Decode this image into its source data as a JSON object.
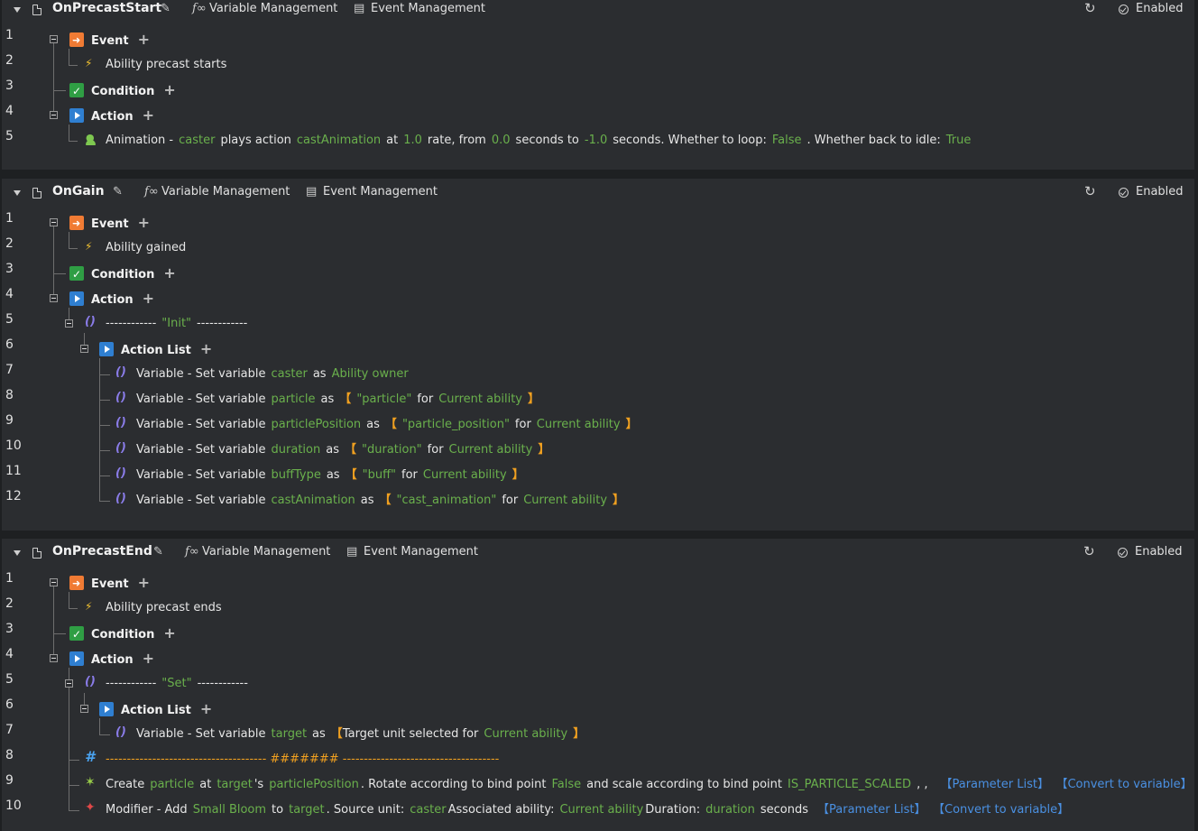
{
  "header_labels": {
    "variable_management": "Variable Management",
    "event_management": "Event Management",
    "enabled": "Enabled",
    "variable_management_icon": "fx-icon",
    "event_management_icon": "doc-arrow-icon"
  },
  "sections": {
    "event": "Event",
    "condition": "Condition",
    "action": "Action",
    "action_list": "Action List"
  },
  "triggers": [
    {
      "name": "OnPrecastStart",
      "lines": [
        "1",
        "2",
        "3",
        "4",
        "5"
      ],
      "event_text": "Ability precast starts",
      "animation": {
        "p1": "Animation -",
        "caster": "caster",
        "p2": "plays action",
        "anim": "castAnimation",
        "p3": "at",
        "rate": "1.0",
        "p4": "rate, from",
        "from": "0.0",
        "p5": "seconds to",
        "to": "-1.0",
        "p6": "seconds. Whether to loop:",
        "loop": "False",
        "p7": ". Whether back to idle:",
        "idle": "True"
      }
    },
    {
      "name": "OnGain",
      "lines": [
        "1",
        "2",
        "3",
        "4",
        "5",
        "6",
        "7",
        "8",
        "9",
        "10",
        "11",
        "12"
      ],
      "event_text": "Ability gained",
      "group_comment": "------------ \"Init\" ------------",
      "group_comment_parts": [
        "------------",
        "\"Init\"",
        "------------"
      ],
      "set_vars": [
        {
          "prefix": "Variable - Set variable",
          "name": "caster",
          "as": "as",
          "value": "Ability owner"
        },
        {
          "prefix": "Variable - Set variable",
          "name": "particle",
          "as": "as",
          "open": "【",
          "key": "\"particle\"",
          "for": "for",
          "target": "Current ability",
          "close": "】"
        },
        {
          "prefix": "Variable - Set variable",
          "name": "particlePosition",
          "as": "as",
          "open": "【",
          "key": "\"particle_position\"",
          "for": "for",
          "target": "Current ability",
          "close": "】"
        },
        {
          "prefix": "Variable - Set variable",
          "name": "duration",
          "as": "as",
          "open": "【",
          "key": "\"duration\"",
          "for": "for",
          "target": "Current ability",
          "close": "】"
        },
        {
          "prefix": "Variable - Set variable",
          "name": "buffType",
          "as": "as",
          "open": "【",
          "key": "\"buff\"",
          "for": "for",
          "target": "Current ability",
          "close": "】"
        },
        {
          "prefix": "Variable - Set variable",
          "name": "castAnimation",
          "as": "as",
          "open": "【",
          "key": "\"cast_animation\"",
          "for": "for",
          "target": "Current ability",
          "close": "】"
        }
      ]
    },
    {
      "name": "OnPrecastEnd",
      "lines": [
        "1",
        "2",
        "3",
        "4",
        "5",
        "6",
        "7",
        "8",
        "9",
        "10"
      ],
      "event_text": "Ability precast ends",
      "group_comment_parts": [
        "------------",
        "\"Set\"",
        "------------"
      ],
      "set_target": {
        "prefix": "Variable - Set variable",
        "name": "target",
        "as": "as",
        "open": "【",
        "text": "Target unit selected for",
        "target": "Current ability",
        "close": "】"
      },
      "comment_line": "-------------------------------------- ####### -------------------------------------",
      "create": {
        "p1": "Create",
        "particle": "particle",
        "p2": "at",
        "target": "target",
        "p3": "'s",
        "pos": "particlePosition",
        "p4": ". Rotate according to bind point",
        "rot": "False",
        "p5": "and scale according to bind point",
        "scaled": "IS_PARTICLE_SCALED",
        "p6": ", ,",
        "params": "【Parameter List】",
        "convert": "【Convert to variable】"
      },
      "modifier": {
        "p1": "Modifier - Add",
        "name": "Small Bloom",
        "p2": "to",
        "target": "target",
        "p3": ". Source unit:",
        "src": "caster",
        "p4": "Associated ability:",
        "ability": "Current ability",
        "p5": "Duration:",
        "dur": "duration",
        "p6": "seconds",
        "params": "【Parameter List】",
        "convert": "【Convert to variable】"
      }
    }
  ],
  "colors": {
    "background": "#1e2022",
    "panel": "#2b2d30",
    "variable_green": "#6ab04c",
    "bracket_orange": "#f0a020",
    "link_blue": "#4a90e2"
  }
}
